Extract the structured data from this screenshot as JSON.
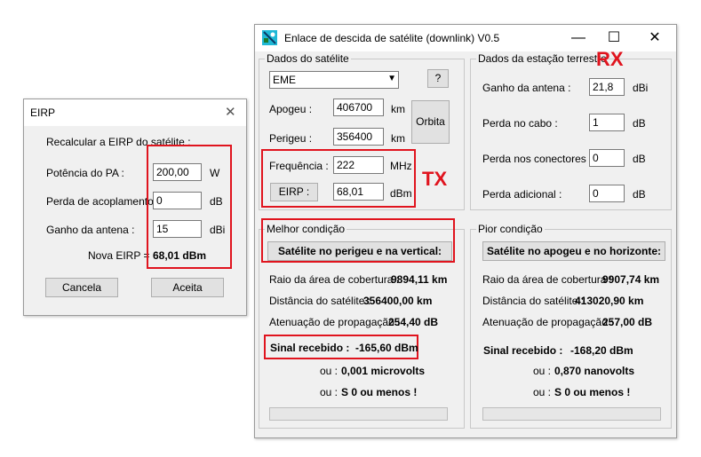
{
  "eirp_dialog": {
    "title": "EIRP",
    "instruction": "Recalcular a EIRP do satélite :",
    "pa_power_label": "Potência do PA :",
    "pa_power_value": "200,00",
    "pa_power_unit": "W",
    "coupling_loss_label": "Perda de acoplamento :",
    "coupling_loss_value": "0",
    "coupling_loss_unit": "dB",
    "antenna_gain_label": "Ganho da antena :",
    "antenna_gain_value": "15",
    "antenna_gain_unit": "dBi",
    "new_eirp_label": "Nova EIRP =",
    "new_eirp_value": "68,01 dBm",
    "cancel_label": "Cancela",
    "accept_label": "Aceita"
  },
  "main_window": {
    "title": "Enlace de descida de satélite (downlink)  V0.5",
    "satellite_group": {
      "title": "Dados do satélite",
      "selected_satellite": "EME",
      "help_label": "?",
      "apogee_label": "Apogeu :",
      "apogee_value": "406700",
      "apogee_unit": "km",
      "perigee_label": "Perigeu :",
      "perigee_value": "356400",
      "perigee_unit": "km",
      "orbit_label": "Orbita",
      "frequency_label": "Frequência :",
      "frequency_value": "222",
      "frequency_unit": "MHz",
      "eirp_button_label": "EIRP :",
      "eirp_value": "68,01",
      "eirp_unit": "dBm"
    },
    "station_group": {
      "title": "Dados da estação terrestre",
      "antenna_gain_label": "Ganho da antena :",
      "antenna_gain_value": "21,8",
      "antenna_gain_unit": "dBi",
      "cable_loss_label": "Perda no cabo :",
      "cable_loss_value": "1",
      "cable_loss_unit": "dB",
      "connector_loss_label": "Perda nos conectores :",
      "connector_loss_value": "0",
      "connector_loss_unit": "dB",
      "additional_loss_label": "Perda adicional :",
      "additional_loss_value": "0",
      "additional_loss_unit": "dB"
    },
    "best_group": {
      "title": "Melhor condição",
      "button_label": "Satélite no perigeu e na vertical:",
      "coverage_label": "Raio da área de cobertura :",
      "coverage_value": "9894,11 km",
      "distance_label": "Distância do satélite :",
      "distance_value": "356400,00 km",
      "attenuation_label": "Atenuação de propagação :",
      "attenuation_value": "254,40 dB",
      "signal_label": "Sinal recebido :",
      "signal_value": "-165,60 dBm",
      "or_label_1": "ou :",
      "or_value_1": "0,001 microvolts",
      "or_label_2": "ou :",
      "or_value_2": "S 0  ou menos !",
      "progress": 0
    },
    "worst_group": {
      "title": "Pior condição",
      "button_label": "Satélite no apogeu e no horizonte:",
      "coverage_label": "Raio da área de cobertura :",
      "coverage_value": "9907,74 km",
      "distance_label": "Distância do satélite :",
      "distance_value": "413020,90 km",
      "attenuation_label": "Atenuação de propagação :",
      "attenuation_value": "257,00 dB",
      "signal_label": "Sinal recebido :",
      "signal_value": "-168,20 dBm",
      "or_label_1": "ou :",
      "or_value_1": "0,870 nanovolts",
      "or_label_2": "ou :",
      "or_value_2": "S 0  ou menos !",
      "progress": 0
    }
  },
  "annotations": {
    "rx": "RX",
    "tx": "TX"
  },
  "colors": {
    "annotation_red": "#e0141e",
    "window_bg": "#f0f0f0"
  },
  "icons": {
    "app_icon": "satellite-icon",
    "minimize": "minimize-icon",
    "maximize": "maximize-icon",
    "close": "close-icon"
  }
}
